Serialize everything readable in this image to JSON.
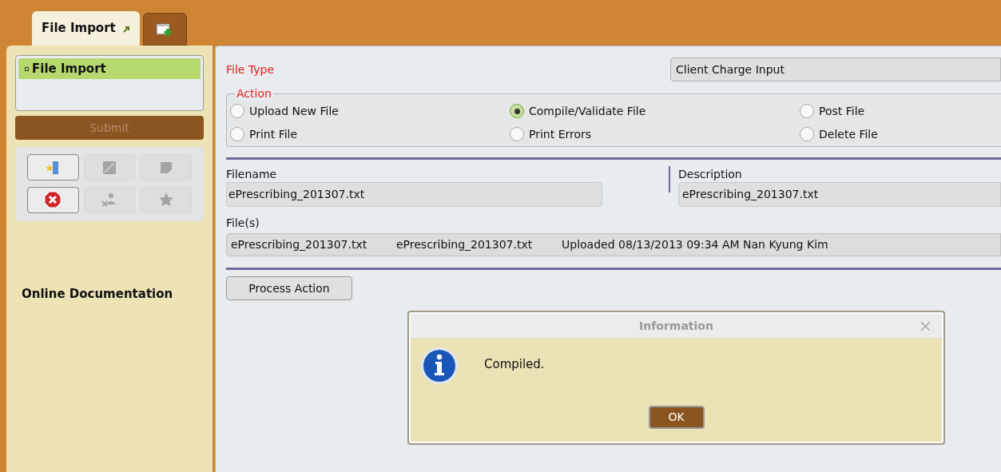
{
  "tabs": [
    {
      "label": "File Import",
      "selected": true
    }
  ],
  "sidebar": {
    "nav_items": [
      {
        "label": "File Import",
        "selected": true
      }
    ],
    "submit": {
      "label": "Submit",
      "disabled": true
    },
    "tools": [
      {
        "kind": "open",
        "disabled": false
      },
      {
        "kind": "edit",
        "disabled": true
      },
      {
        "kind": "note",
        "disabled": true
      },
      {
        "kind": "delete",
        "disabled": false
      },
      {
        "kind": "unlink",
        "disabled": true
      },
      {
        "kind": "favorite",
        "disabled": true
      }
    ],
    "online_documentation": "Online Documentation"
  },
  "form": {
    "file_type": {
      "label": "File Type",
      "value": "Client Charge Input"
    },
    "action": {
      "legend": "Action",
      "options": [
        {
          "label": "Upload New File",
          "selected": false
        },
        {
          "label": "Compile/Validate File",
          "selected": true
        },
        {
          "label": "Post File",
          "selected": false
        },
        {
          "label": "Print File",
          "selected": false
        },
        {
          "label": "Print Errors",
          "selected": false
        },
        {
          "label": "Delete File",
          "selected": false
        }
      ]
    },
    "filename": {
      "label": "Filename",
      "value": "ePrescribing_201307.txt"
    },
    "description": {
      "label": "Description",
      "value": "ePrescribing_201307.txt"
    },
    "files": {
      "label": "File(s)",
      "row": [
        "ePrescribing_201307.txt",
        "ePrescribing_201307.txt",
        "Uploaded 08/13/2013 09:34 AM Nan Kyung Kim"
      ]
    },
    "process_button": "Process Action"
  },
  "dialog": {
    "title": "Information",
    "message": "Compiled.",
    "ok": "OK"
  }
}
